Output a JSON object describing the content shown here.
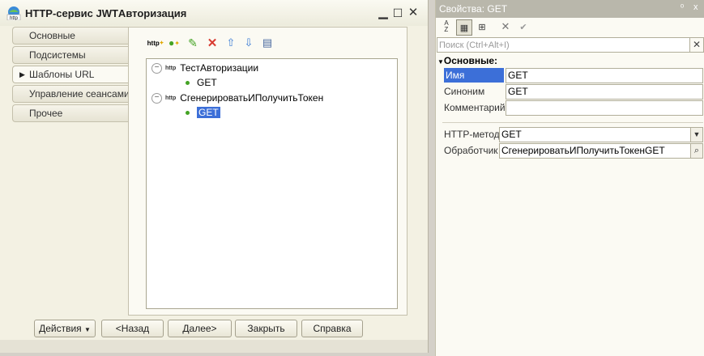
{
  "window": {
    "title": "HTTP-сервис JWTАвторизация",
    "icon_label": "http",
    "minimize_icon": "minimize-icon",
    "maximize_icon": "maximize-icon",
    "close_icon": "close-icon"
  },
  "tabs": [
    {
      "label": "Основные",
      "active": false
    },
    {
      "label": "Подсистемы",
      "active": false
    },
    {
      "label": "Шаблоны URL",
      "active": true
    },
    {
      "label": "Управление сеансами",
      "active": false
    },
    {
      "label": "Прочее",
      "active": false
    }
  ],
  "toolbar": {
    "http_icon_label": "http",
    "icons": [
      "add-template-icon",
      "add-method-icon",
      "edit-icon",
      "delete-icon",
      "move-up-icon",
      "move-down-icon",
      "list-icon"
    ]
  },
  "tree": {
    "http_label": "http",
    "nodes": [
      {
        "label": "ТестАвторизации",
        "children": [
          {
            "label": "GET",
            "selected": false
          }
        ]
      },
      {
        "label": "СгенерироватьИПолучитьТокен",
        "children": [
          {
            "label": "GET",
            "selected": true
          }
        ]
      }
    ]
  },
  "buttons": {
    "actions": "Действия",
    "back": "<Назад",
    "next": "Далее>",
    "close": "Закрыть",
    "help": "Справка"
  },
  "properties": {
    "title": "Свойства: GET",
    "title_pin": "ᵒ",
    "title_close": "x",
    "search_placeholder": "Поиск (Ctrl+Alt+I)",
    "section": "Основные:",
    "name_label": "Имя",
    "name_value": "GET",
    "synonym_label": "Синоним",
    "synonym_value": "GET",
    "comment_label": "Комментарий",
    "comment_value": "",
    "method_label": "HTTP-метод",
    "method_value": "GET",
    "handler_label": "Обработчик",
    "handler_value": "СгенерироватьИПолучитьТокенGET"
  },
  "colors": {
    "selection": "#3c6fd8",
    "window_bg": "#f3f1e3",
    "panel_title_bg": "#b9b7ab",
    "delete_red": "#d83a30",
    "arrow_blue": "#3a7bd5",
    "add_green": "#44a324"
  }
}
